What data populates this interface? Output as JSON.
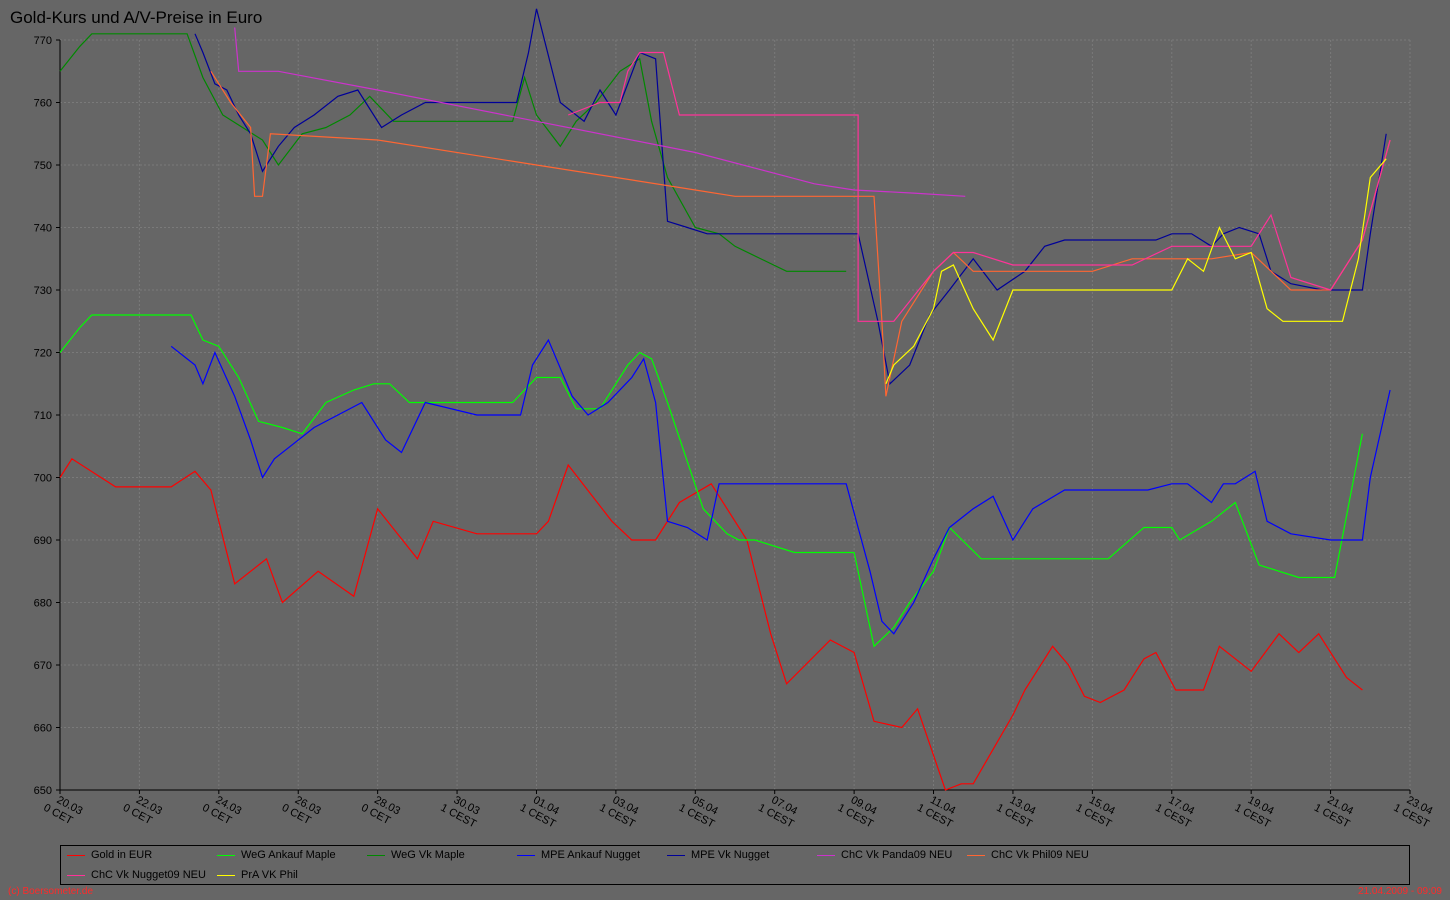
{
  "title": "Gold-Kurs und A/V-Preise in Euro",
  "footer": {
    "credit": "(c) Boersometer.de",
    "timestamp": "21.04.2009 - 09:09"
  },
  "chart_data": {
    "type": "line",
    "title": "Gold-Kurs und A/V-Preise in Euro",
    "xlabel": "",
    "ylabel": "",
    "ylim": [
      650,
      770
    ],
    "yticks": [
      650,
      660,
      670,
      680,
      690,
      700,
      710,
      720,
      730,
      740,
      750,
      760,
      770
    ],
    "xticks": [
      {
        "date": "20.03",
        "zone": "0 CET"
      },
      {
        "date": "22.03",
        "zone": "0 CET"
      },
      {
        "date": "24.03",
        "zone": "0 CET"
      },
      {
        "date": "26.03",
        "zone": "0 CET"
      },
      {
        "date": "28.03",
        "zone": "0 CET"
      },
      {
        "date": "30.03",
        "zone": "1 CEST"
      },
      {
        "date": "01.04",
        "zone": "1 CEST"
      },
      {
        "date": "03.04",
        "zone": "1 CEST"
      },
      {
        "date": "05.04",
        "zone": "1 CEST"
      },
      {
        "date": "07.04",
        "zone": "1 CEST"
      },
      {
        "date": "09.04",
        "zone": "1 CEST"
      },
      {
        "date": "11.04",
        "zone": "1 CEST"
      },
      {
        "date": "13.04",
        "zone": "1 CEST"
      },
      {
        "date": "15.04",
        "zone": "1 CEST"
      },
      {
        "date": "17.04",
        "zone": "1 CEST"
      },
      {
        "date": "19.04",
        "zone": "1 CEST"
      },
      {
        "date": "21.04",
        "zone": "1 CEST"
      },
      {
        "date": "23.04",
        "zone": "1 CEST"
      }
    ],
    "grid": true,
    "legend_position": "bottom",
    "series": [
      {
        "name": "Gold in EUR",
        "color": "#ff0000",
        "x": [
          0,
          0.3,
          1.4,
          2.8,
          3.4,
          3.8,
          4.4,
          5.2,
          5.6,
          6.5,
          7.4,
          8.0,
          9.0,
          9.4,
          10.5,
          11.0,
          12.0,
          12.3,
          12.8,
          13.9,
          14.4,
          15.0,
          15.6,
          16.4,
          17.3,
          17.9,
          18.3,
          19.4,
          20.0,
          20.5,
          21.2,
          21.6,
          22.3,
          22.7,
          23.0,
          24.0,
          24.3,
          25.0,
          25.4,
          25.8,
          26.2,
          26.8,
          27.3,
          27.6,
          28.1,
          28.4,
          28.8,
          29.2,
          30.0,
          30.7,
          31.2,
          31.7,
          32.4,
          32.8
        ],
        "y": [
          700,
          703,
          698.5,
          698.5,
          701,
          698,
          683,
          687,
          680,
          685,
          681,
          695,
          687,
          693,
          691,
          691,
          691,
          693,
          702,
          693,
          690,
          690,
          696,
          699,
          690,
          675,
          667,
          674,
          672,
          661,
          660,
          663,
          650,
          651,
          651,
          662,
          666,
          673,
          670,
          665,
          664,
          666,
          671,
          672,
          666,
          666,
          666,
          673,
          669,
          675,
          672,
          675,
          668,
          666
        ]
      },
      {
        "name": "WeG Ankauf Maple",
        "color": "#00ff00",
        "x": [
          0,
          0.5,
          0.8,
          3.3,
          3.6,
          4.0,
          4.5,
          5.0,
          5.6,
          6.1,
          6.7,
          7.4,
          7.9,
          8.3,
          8.8,
          9.4,
          10.4,
          11.4,
          12.0,
          12.6,
          13.0,
          13.6,
          14.3,
          14.6,
          14.9,
          15.3,
          16.2,
          16.8,
          17.1,
          17.5,
          18.5,
          19.4,
          20.0,
          20.5,
          21.0,
          21.4,
          22.0,
          22.4,
          23.2,
          24.0,
          24.9,
          25.6,
          26.4,
          27.3,
          28.0,
          28.2,
          29.0,
          29.6,
          30.2,
          31.2,
          31.4,
          32.1,
          32.8
        ],
        "y": [
          720,
          724,
          726,
          726,
          722,
          721,
          716,
          709,
          708,
          707,
          712,
          714,
          715,
          715,
          712,
          712,
          712,
          712,
          716,
          716,
          711,
          711,
          718,
          720,
          719,
          712,
          695,
          691,
          690,
          690,
          688,
          688,
          688,
          673,
          676,
          680,
          685,
          692,
          687,
          687,
          687,
          687,
          687,
          692,
          692,
          690,
          693,
          696,
          686,
          684,
          684,
          684,
          707
        ]
      },
      {
        "name": "WeG Vk Maple",
        "color": "#008800",
        "x": [
          0,
          0.5,
          0.8,
          3.2,
          3.6,
          4.1,
          4.6,
          5.1,
          5.5,
          6.1,
          6.7,
          7.3,
          7.8,
          8.4,
          9.0,
          9.8,
          10.5,
          11.4,
          11.7,
          12.0,
          12.6,
          13.0,
          13.5,
          14.1,
          14.6,
          14.9,
          15.3,
          16.0,
          16.6,
          17.0,
          18.3,
          19.3,
          19.8
        ],
        "y": [
          765,
          769,
          771,
          771,
          764,
          758,
          756,
          754,
          750,
          755,
          756,
          758,
          761,
          757,
          757,
          757,
          757,
          757,
          764,
          758,
          753,
          757,
          760,
          765,
          767,
          757,
          748,
          740,
          739,
          737,
          733,
          733,
          733
        ]
      },
      {
        "name": "MPE Ankauf Nugget",
        "color": "#0000ff",
        "x": [
          2.8,
          3.4,
          3.6,
          3.9,
          4.4,
          4.8,
          5.1,
          5.4,
          5.8,
          6.4,
          7.0,
          7.6,
          8.2,
          8.6,
          9.2,
          10.5,
          11.4,
          11.6,
          11.9,
          12.3,
          12.9,
          13.3,
          13.8,
          14.4,
          14.7,
          15.0,
          15.3,
          15.8,
          16.3,
          16.6,
          17.3,
          18.5,
          19.0,
          19.8,
          20.4,
          20.7,
          21.0,
          21.5,
          22.0,
          22.4,
          23.0,
          23.5,
          24.0,
          24.5,
          25.3,
          26.3,
          27.4,
          28.0,
          28.4,
          29.0,
          29.3,
          29.6,
          30.1,
          30.4,
          31.0,
          32.0,
          32.5,
          32.8,
          33.0,
          33.5
        ],
        "y": [
          721,
          718,
          715,
          720,
          713,
          706,
          700,
          703,
          705,
          708,
          710,
          712,
          706,
          704,
          712,
          710,
          710,
          710,
          718,
          722,
          713,
          710,
          712,
          716,
          719,
          712,
          693,
          692,
          690,
          699,
          699,
          699,
          699,
          699,
          685,
          677,
          675,
          680,
          687,
          692,
          695,
          697,
          690,
          695,
          698,
          698,
          698,
          699,
          699,
          696,
          699,
          699,
          701,
          693,
          691,
          690,
          690,
          690,
          700,
          714
        ]
      },
      {
        "name": "MPE Vk Nugget",
        "color": "#000099",
        "x": [
          3.4,
          3.6,
          3.9,
          4.2,
          4.5,
          4.8,
          5.1,
          5.5,
          5.9,
          6.4,
          7.0,
          7.5,
          8.1,
          8.6,
          9.2,
          10.1,
          11.2,
          11.5,
          11.8,
          12.0,
          12.6,
          13.2,
          13.6,
          14.0,
          14.6,
          15.0,
          15.3,
          15.8,
          16.3,
          16.6,
          17.3,
          18.6,
          19.6,
          20.1,
          20.6,
          20.9,
          21.4,
          21.9,
          22.4,
          23.0,
          23.6,
          24.3,
          24.8,
          25.3,
          26.4,
          27.2,
          27.6,
          28.0,
          28.5,
          29.0,
          29.3,
          29.7,
          30.2,
          30.5,
          31.0,
          31.8,
          32.5,
          32.8,
          33.0,
          33.4
        ],
        "y": [
          771,
          768,
          763,
          762,
          758,
          755,
          749,
          753,
          756,
          758,
          761,
          762,
          756,
          758,
          760,
          760,
          760,
          760,
          768,
          775,
          760,
          757,
          762,
          758,
          768,
          767,
          741,
          740,
          739,
          739,
          739,
          739,
          739,
          739,
          725,
          715,
          718,
          726,
          730,
          735,
          730,
          733,
          737,
          738,
          738,
          738,
          738,
          739,
          739,
          737,
          739,
          740,
          739,
          733,
          731,
          730,
          730,
          730,
          739,
          755
        ]
      },
      {
        "name": "ChC Vk Panda09 NEU",
        "color": "#cc33cc",
        "x": [
          4.4,
          4.5,
          5.5,
          8.0,
          12.0,
          16.0,
          19.0,
          20.0,
          21.5,
          22.8
        ],
        "y": [
          772,
          765,
          765,
          762,
          757,
          752,
          747,
          746,
          745.5,
          745
        ]
      },
      {
        "name": "ChC Vk Phil09 NEU",
        "color": "#ff6633",
        "x": [
          3.8,
          4.3,
          4.8,
          4.9,
          5.1,
          5.3,
          8.0,
          12.0,
          16.0,
          17.0,
          19.0,
          20.0,
          20.5,
          20.7,
          20.8,
          21.2,
          22.0,
          22.5,
          23.0,
          24.0,
          25.0,
          26.0,
          27.0,
          28.0,
          29.0,
          30.0,
          31.0,
          32.0,
          32.8,
          33.5
        ],
        "y": [
          765,
          760,
          756,
          745,
          745,
          755,
          754,
          750,
          746,
          745,
          745,
          745,
          745,
          725,
          713,
          725,
          733,
          736,
          733,
          733,
          733,
          733,
          735,
          735,
          735,
          736,
          730,
          730,
          738,
          754
        ]
      },
      {
        "name": "ChC Vk Nugget09 NEU",
        "color": "#ff3399",
        "x": [
          12.8,
          13.6,
          14.1,
          14.3,
          14.6,
          15.0,
          15.2,
          15.6,
          16.5,
          19.0,
          20.1,
          20.1,
          21.0,
          21.5,
          22.0,
          22.5,
          23.0,
          24.0,
          24.5,
          25.0,
          26.0,
          27.0,
          28.0,
          29.0,
          30.0,
          30.5,
          31.0,
          32.0,
          32.8,
          33.5
        ],
        "y": [
          758,
          760,
          760,
          765,
          768,
          768,
          768,
          758,
          758,
          758,
          758,
          725,
          725,
          729,
          733,
          736,
          736,
          734,
          734,
          734,
          734,
          734,
          737,
          737,
          737,
          742,
          732,
          730,
          738,
          754
        ]
      },
      {
        "name": "PrA VK Phil",
        "color": "#ffff00",
        "x": [
          20.8,
          21.0,
          21.5,
          22.0,
          22.2,
          22.5,
          23.0,
          23.5,
          24.0,
          24.5,
          25.0,
          26.0,
          27.0,
          28.0,
          28.4,
          28.8,
          29.2,
          29.6,
          30.0,
          30.4,
          30.8,
          31.0,
          32.0,
          32.3,
          32.7,
          33.0,
          33.4
        ],
        "y": [
          715,
          718,
          721,
          727,
          733,
          734,
          727,
          722,
          730,
          730,
          730,
          730,
          730,
          730,
          735,
          733,
          740,
          735,
          736,
          727,
          725,
          725,
          725,
          725,
          735,
          748,
          751
        ]
      }
    ]
  }
}
